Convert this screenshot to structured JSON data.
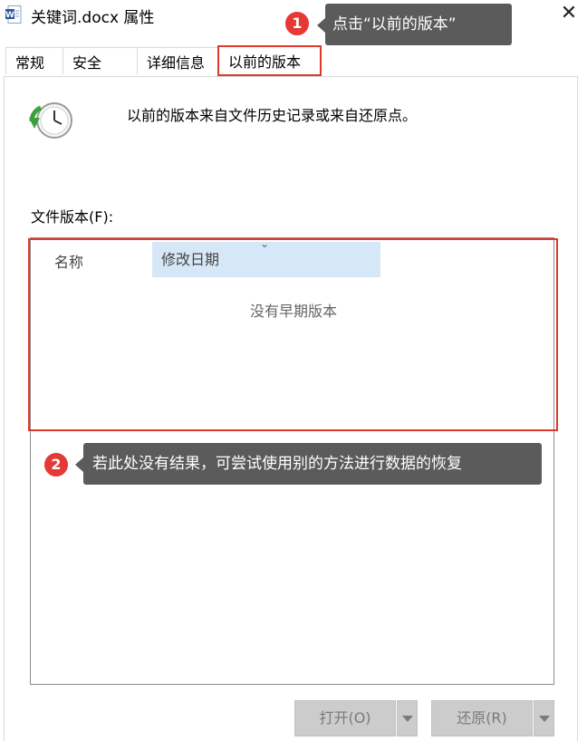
{
  "window": {
    "title": "关键词.docx 属性",
    "close_glyph": "✕",
    "icon": "word-doc-icon"
  },
  "tabs": [
    {
      "label": "常规"
    },
    {
      "label": "安全"
    },
    {
      "label": "详细信息"
    },
    {
      "label": "以前的版本",
      "active": true
    }
  ],
  "panel": {
    "icon": "clock-restore-icon",
    "description": "以前的版本来自文件历史记录或来自还原点。",
    "list_label": "文件版本(F):",
    "columns": {
      "name": "名称",
      "date": "修改日期"
    },
    "sort_indicator": "⌄",
    "empty_message": "没有早期版本"
  },
  "callouts": {
    "step1": {
      "number": "1",
      "text": "点击“以前的版本”"
    },
    "step2": {
      "number": "2",
      "text": "若此处没有结果，可尝试使用别的方法进行数据的恢复"
    }
  },
  "buttons": {
    "open": "打开(O)",
    "restore": "还原(R)"
  },
  "colors": {
    "highlight_red": "#e0392a",
    "callout_bg": "#5b5b5b",
    "badge_red": "#e53935",
    "column_selected_bg": "#d6e7f7"
  }
}
